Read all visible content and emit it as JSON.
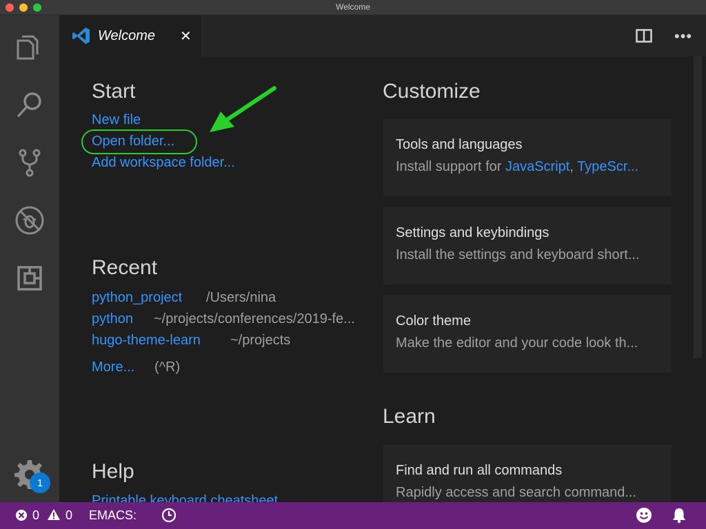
{
  "window": {
    "title": "Welcome"
  },
  "tab": {
    "label": "Welcome",
    "close": "✕"
  },
  "start": {
    "heading": "Start",
    "links": [
      "New file",
      "Open folder...",
      "Add workspace folder..."
    ]
  },
  "recent": {
    "heading": "Recent",
    "items": [
      {
        "name": "python_project",
        "path": "/Users/nina"
      },
      {
        "name": "python",
        "path": "~/projects/conferences/2019-fe..."
      },
      {
        "name": "hugo-theme-learn",
        "path": "~/projects"
      }
    ],
    "more_label": "More...",
    "more_shortcut": "(^R)"
  },
  "help": {
    "heading": "Help",
    "links": [
      "Printable keyboard cheatsheet"
    ]
  },
  "customize": {
    "heading": "Customize",
    "cards": [
      {
        "title": "Tools and languages",
        "desc_prefix": "Install support for ",
        "desc_link1": "JavaScript",
        "desc_sep": ", ",
        "desc_link2": "TypeScr..."
      },
      {
        "title": "Settings and keybindings",
        "desc": "Install the settings and keyboard short..."
      },
      {
        "title": "Color theme",
        "desc": "Make the editor and your code look th..."
      }
    ]
  },
  "learn": {
    "heading": "Learn",
    "cards": [
      {
        "title": "Find and run all commands",
        "desc": "Rapidly access and search command..."
      }
    ]
  },
  "activity": {
    "settings_badge": "1"
  },
  "statusbar": {
    "errors": "0",
    "warnings": "0",
    "mode": "EMACS:"
  },
  "colors": {
    "accent_link": "#3794ff",
    "statusbar": "#68217a",
    "annotation": "#2ad02a"
  }
}
